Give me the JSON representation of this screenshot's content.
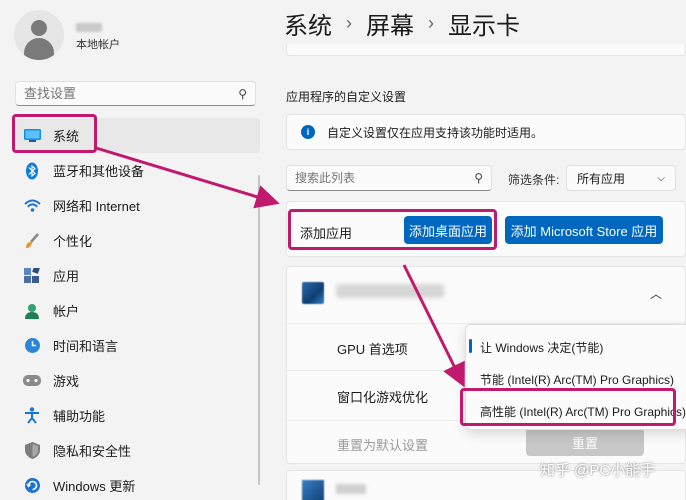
{
  "sidebar": {
    "account_label": "本地帐户",
    "search_placeholder": "查找设置",
    "items": [
      {
        "label": "系统",
        "icon": "monitor-icon",
        "active": true
      },
      {
        "label": "蓝牙和其他设备",
        "icon": "bluetooth-icon"
      },
      {
        "label": "网络和 Internet",
        "icon": "wifi-icon"
      },
      {
        "label": "个性化",
        "icon": "brush-icon"
      },
      {
        "label": "应用",
        "icon": "apps-icon"
      },
      {
        "label": "帐户",
        "icon": "account-icon"
      },
      {
        "label": "时间和语言",
        "icon": "clock-globe-icon"
      },
      {
        "label": "游戏",
        "icon": "gamepad-icon"
      },
      {
        "label": "辅助功能",
        "icon": "accessibility-icon"
      },
      {
        "label": "隐私和安全性",
        "icon": "shield-icon"
      },
      {
        "label": "Windows 更新",
        "icon": "update-icon"
      }
    ]
  },
  "header": {
    "breadcrumb": [
      "系统",
      "屏幕",
      "显示卡"
    ],
    "separator": "›"
  },
  "main": {
    "section_title": "应用程序的自定义设置",
    "info_text": "自定义设置仅在应用支持该功能时适用。",
    "list_search_placeholder": "搜索此列表",
    "filter_label": "筛选条件:",
    "filter_value": "所有应用",
    "add_app_label": "添加应用",
    "add_desktop_button": "添加桌面应用",
    "add_store_button": "添加 Microsoft Store 应用",
    "rows": {
      "gpu_pref": "GPU 首选项",
      "windowed_opt": "窗口化游戏优化",
      "reset_label": "重置为默认设置",
      "reset_button": "重置"
    }
  },
  "dropdown": {
    "options": [
      "让 Windows 决定(节能)",
      "节能 (Intel(R) Arc(TM) Pro Graphics)",
      "高性能 (Intel(R) Arc(TM) Pro Graphics)"
    ],
    "selected_index": 0
  },
  "watermark": "知乎 @PC小能手",
  "colors": {
    "accent": "#0067c0",
    "annotation": "#c0196e"
  }
}
